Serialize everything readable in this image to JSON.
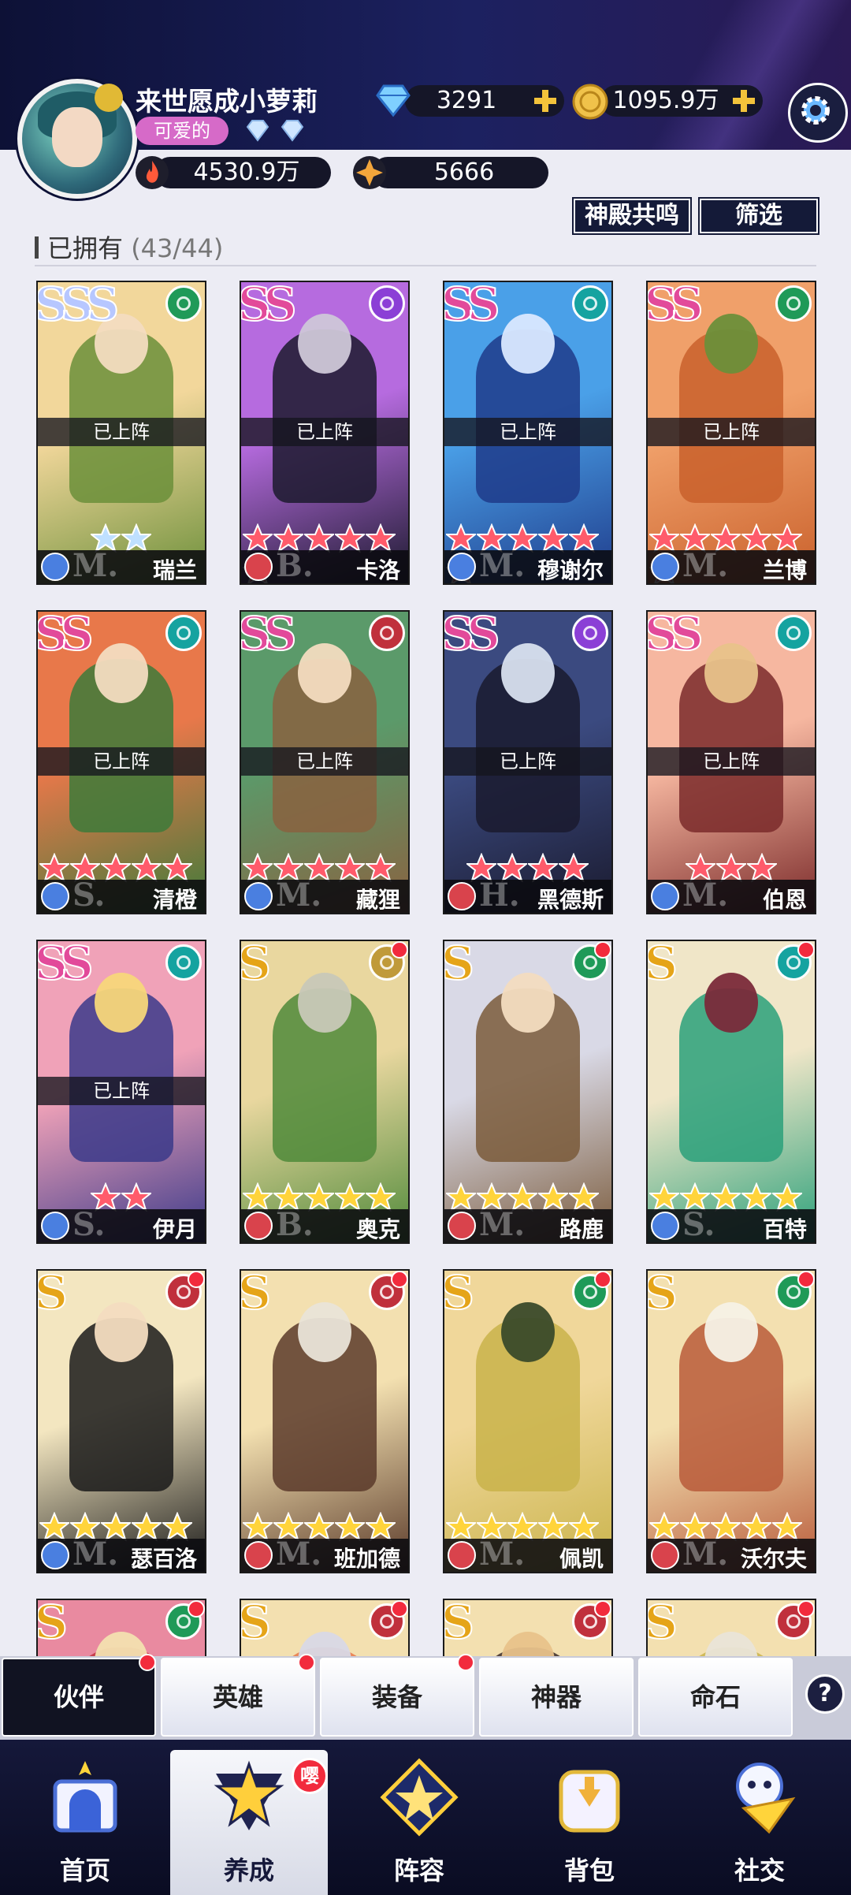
{
  "profile": {
    "name": "来世愿成小萝莉",
    "tag": "可爱的",
    "power": "4530.9万",
    "honor": "5666"
  },
  "currency": {
    "diamonds": "3291",
    "gold": "1095.9万"
  },
  "actions": {
    "resonance": "神殿共鸣",
    "filter": "筛选"
  },
  "collection": {
    "label": "已拥有",
    "count": "(43/44)",
    "deployed_label": "已上阵"
  },
  "cards": [
    {
      "name": "瑞兰",
      "rarity": "SSS",
      "faction": "forest",
      "faction_color": "#1f9a58",
      "stars": 2,
      "star_color": "blue",
      "deployed": true,
      "class_letter": "M.",
      "type_color": "#4a7fe0",
      "art": [
        "#f2d79b",
        "#6b8f3a",
        "#f3dcc0"
      ],
      "dot": false
    },
    {
      "name": "卡洛",
      "rarity": "SS",
      "faction": "dark",
      "faction_color": "#8b3fd6",
      "stars": 6,
      "star_color": "red",
      "deployed": true,
      "class_letter": "B.",
      "type_color": "#d9434c",
      "art": [
        "#b66bdf",
        "#1c1a2e",
        "#cfc7d8"
      ],
      "dot": false
    },
    {
      "name": "穆谢尔",
      "rarity": "SS",
      "faction": "abyss",
      "faction_color": "#15a3a0",
      "stars": 6,
      "star_color": "red",
      "deployed": true,
      "class_letter": "M.",
      "type_color": "#4a7fe0",
      "art": [
        "#4aa0e8",
        "#1f3b8a",
        "#d9e8ff"
      ],
      "dot": false
    },
    {
      "name": "兰博",
      "rarity": "SS",
      "faction": "forest",
      "faction_color": "#1f9a58",
      "stars": 6,
      "star_color": "red",
      "deployed": true,
      "class_letter": "M.",
      "type_color": "#4a7fe0",
      "art": [
        "#f0a06a",
        "#c9602b",
        "#6b8f3a"
      ],
      "dot": false
    },
    {
      "name": "清橙",
      "rarity": "SS",
      "faction": "abyss",
      "faction_color": "#15a3a0",
      "stars": 5,
      "star_color": "red",
      "deployed": true,
      "class_letter": "S.",
      "type_color": "#4a7fe0",
      "art": [
        "#e8784a",
        "#3d7a3a",
        "#f3dcc0"
      ],
      "dot": false
    },
    {
      "name": "藏狸",
      "rarity": "SS",
      "faction": "shadow",
      "faction_color": "#c0303c",
      "stars": 5,
      "star_color": "red",
      "deployed": true,
      "class_letter": "M.",
      "type_color": "#4a7fe0",
      "art": [
        "#5b9a6a",
        "#8a6240",
        "#f3dcc0"
      ],
      "dot": false
    },
    {
      "name": "黑德斯",
      "rarity": "SS",
      "faction": "dark",
      "faction_color": "#8b3fd6",
      "stars": 4,
      "star_color": "red",
      "deployed": true,
      "class_letter": "H.",
      "type_color": "#d9434c",
      "art": [
        "#3b4a80",
        "#1a1a2e",
        "#d8e0ee"
      ],
      "dot": false
    },
    {
      "name": "伯恩",
      "rarity": "SS",
      "faction": "abyss",
      "faction_color": "#15a3a0",
      "stars": 3,
      "star_color": "red",
      "deployed": true,
      "class_letter": "M.",
      "type_color": "#4a7fe0",
      "art": [
        "#f6b7a0",
        "#7a2a2a",
        "#e8c28a"
      ],
      "dot": false
    },
    {
      "name": "伊月",
      "rarity": "SS",
      "faction": "abyss",
      "faction_color": "#15a3a0",
      "stars": 2,
      "star_color": "red",
      "deployed": true,
      "class_letter": "S.",
      "type_color": "#4a7fe0",
      "art": [
        "#f0a2b8",
        "#3b3a8a",
        "#f7d77a"
      ],
      "dot": false
    },
    {
      "name": "奥克",
      "rarity": "S",
      "faction": "light",
      "faction_color": "#c09a3a",
      "stars": 5,
      "star_color": "gold",
      "deployed": false,
      "class_letter": "B.",
      "type_color": "#d9434c",
      "art": [
        "#e9d79f",
        "#4f8a3a",
        "#c8c8b8"
      ],
      "dot": true
    },
    {
      "name": "路鹿",
      "rarity": "S",
      "faction": "forest",
      "faction_color": "#1f9a58",
      "stars": 5,
      "star_color": "gold",
      "deployed": false,
      "class_letter": "M.",
      "type_color": "#d9434c",
      "art": [
        "#d9d9e6",
        "#7a5a3a",
        "#f3dcc0"
      ],
      "dot": true
    },
    {
      "name": "百特",
      "rarity": "S",
      "faction": "abyss",
      "faction_color": "#15a3a0",
      "stars": 5,
      "star_color": "gold",
      "deployed": false,
      "class_letter": "S.",
      "type_color": "#4a7fe0",
      "art": [
        "#f0e6c8",
        "#2aa07a",
        "#7a2a3a"
      ],
      "dot": true
    },
    {
      "name": "瑟百洛",
      "rarity": "S",
      "faction": "shadow",
      "faction_color": "#c0303c",
      "stars": 5,
      "star_color": "gold",
      "deployed": false,
      "class_letter": "M.",
      "type_color": "#4a7fe0",
      "art": [
        "#f3e6c0",
        "#1a1a1a",
        "#f3dcc0"
      ],
      "dot": true
    },
    {
      "name": "班加德",
      "rarity": "S",
      "faction": "shadow",
      "faction_color": "#c0303c",
      "stars": 5,
      "star_color": "gold",
      "deployed": false,
      "class_letter": "M.",
      "type_color": "#d9434c",
      "art": [
        "#f3e0b0",
        "#5a3a2a",
        "#e9e4d8"
      ],
      "dot": true
    },
    {
      "name": "佩凯",
      "rarity": "S",
      "faction": "forest",
      "faction_color": "#1f9a58",
      "stars": 5,
      "star_color": "gold",
      "deployed": false,
      "class_letter": "M.",
      "type_color": "#d9434c",
      "art": [
        "#f0d79a",
        "#c9b34a",
        "#3a4a2a"
      ],
      "dot": true
    },
    {
      "name": "沃尔夫",
      "rarity": "S",
      "faction": "forest",
      "faction_color": "#1f9a58",
      "stars": 5,
      "star_color": "gold",
      "deployed": false,
      "class_letter": "M.",
      "type_color": "#d9434c",
      "art": [
        "#f3e0b0",
        "#b85a3a",
        "#f6f1e6"
      ],
      "dot": true
    },
    {
      "name": "",
      "rarity": "S",
      "faction": "forest",
      "faction_color": "#1f9a58",
      "stars": 0,
      "star_color": "gold",
      "deployed": false,
      "class_letter": "",
      "type_color": "#d9434c",
      "art": [
        "#e98aa0",
        "#c0303c",
        "#f3e0b0"
      ],
      "dot": true
    },
    {
      "name": "",
      "rarity": "S",
      "faction": "shadow",
      "faction_color": "#c0303c",
      "stars": 0,
      "star_color": "gold",
      "deployed": false,
      "class_letter": "",
      "type_color": "#d9434c",
      "art": [
        "#f3e0b0",
        "#e8784a",
        "#d8d8e6"
      ],
      "dot": true
    },
    {
      "name": "",
      "rarity": "S",
      "faction": "shadow",
      "faction_color": "#c0303c",
      "stars": 0,
      "star_color": "gold",
      "deployed": false,
      "class_letter": "",
      "type_color": "#d9434c",
      "art": [
        "#f3e0b0",
        "#3a2a2a",
        "#e8c28a"
      ],
      "dot": true
    },
    {
      "name": "",
      "rarity": "S",
      "faction": "shadow",
      "faction_color": "#c0303c",
      "stars": 0,
      "star_color": "gold",
      "deployed": false,
      "class_letter": "",
      "type_color": "#d9434c",
      "art": [
        "#f3e0b0",
        "#c9b34a",
        "#e9e4d8"
      ],
      "dot": true
    }
  ],
  "subtabs": [
    {
      "label": "伙伴",
      "active": true,
      "dot": true
    },
    {
      "label": "英雄",
      "active": false,
      "dot": true
    },
    {
      "label": "装备",
      "active": false,
      "dot": true
    },
    {
      "label": "神器",
      "active": false,
      "dot": false
    },
    {
      "label": "命石",
      "active": false,
      "dot": false
    }
  ],
  "help": "?",
  "nav": [
    {
      "label": "首页",
      "icon": "castle-icon",
      "active": false
    },
    {
      "label": "养成",
      "icon": "star-upgrade-icon",
      "active": true,
      "badge": "嘤"
    },
    {
      "label": "阵容",
      "icon": "formation-icon",
      "active": false
    },
    {
      "label": "背包",
      "icon": "backpack-icon",
      "active": false
    },
    {
      "label": "社交",
      "icon": "social-icon",
      "active": false
    }
  ],
  "colors": {
    "accent": "#f22b3d",
    "header_bg": "#0d1136",
    "nav_bg": "#15183a"
  }
}
